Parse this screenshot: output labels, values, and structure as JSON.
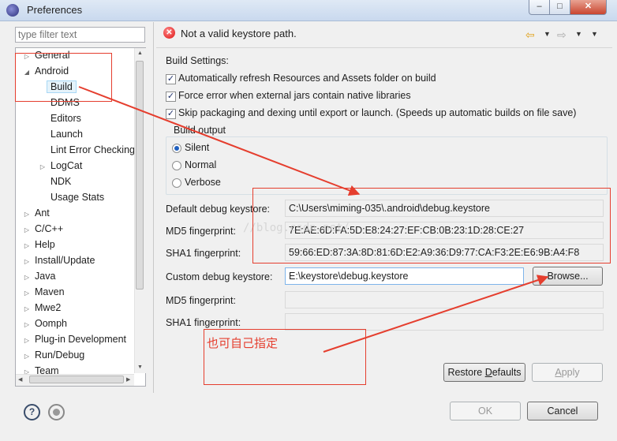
{
  "window": {
    "title": "Preferences",
    "buttons": [
      "–",
      "□",
      "✕"
    ]
  },
  "sidebar": {
    "filter_placeholder": "type filter text",
    "tree": [
      {
        "label": "General",
        "twisty": "▷",
        "depth": 0
      },
      {
        "label": "Android",
        "twisty": "◢",
        "depth": 0
      },
      {
        "label": "Build",
        "twisty": "",
        "depth": 1,
        "selected": true
      },
      {
        "label": "DDMS",
        "twisty": "",
        "depth": 1
      },
      {
        "label": "Editors",
        "twisty": "",
        "depth": 1
      },
      {
        "label": "Launch",
        "twisty": "",
        "depth": 1
      },
      {
        "label": "Lint Error Checking",
        "twisty": "",
        "depth": 1
      },
      {
        "label": "LogCat",
        "twisty": "▷",
        "depth": 1
      },
      {
        "label": "NDK",
        "twisty": "",
        "depth": 1
      },
      {
        "label": "Usage Stats",
        "twisty": "",
        "depth": 1
      },
      {
        "label": "Ant",
        "twisty": "▷",
        "depth": 0
      },
      {
        "label": "C/C++",
        "twisty": "▷",
        "depth": 0
      },
      {
        "label": "Help",
        "twisty": "▷",
        "depth": 0
      },
      {
        "label": "Install/Update",
        "twisty": "▷",
        "depth": 0
      },
      {
        "label": "Java",
        "twisty": "▷",
        "depth": 0
      },
      {
        "label": "Maven",
        "twisty": "▷",
        "depth": 0
      },
      {
        "label": "Mwe2",
        "twisty": "▷",
        "depth": 0
      },
      {
        "label": "Oomph",
        "twisty": "▷",
        "depth": 0
      },
      {
        "label": "Plug-in Development",
        "twisty": "▷",
        "depth": 0
      },
      {
        "label": "Run/Debug",
        "twisty": "▷",
        "depth": 0
      },
      {
        "label": "Team",
        "twisty": "▷",
        "depth": 0
      }
    ]
  },
  "header": {
    "message": "Not a valid keystore path."
  },
  "build_settings": {
    "title": "Build Settings:",
    "options": [
      {
        "label": "Automatically refresh Resources and Assets folder on build",
        "checked": true
      },
      {
        "label": "Force error when external jars contain native libraries",
        "checked": true
      },
      {
        "label": "Skip packaging and dexing until export or launch. (Speeds up automatic builds on file save)",
        "checked": true
      }
    ],
    "output_group": "Build output",
    "output_options": [
      {
        "label": "Silent",
        "selected": true
      },
      {
        "label": "Normal",
        "selected": false
      },
      {
        "label": "Verbose",
        "selected": false
      }
    ]
  },
  "keystore": {
    "default_label": "Default debug keystore:",
    "default_value": "C:\\Users\\miming-035\\.android\\debug.keystore",
    "md5_label": "MD5 fingerprint:",
    "md5_value": "7E:AE:6D:FA:5D:E8:24:27:EF:CB:0B:23:1D:28:CE:27",
    "sha1_label": "SHA1 fingerprint:",
    "sha1_value": "59:66:ED:87:3A:8D:81:6D:E2:A9:36:D9:77:CA:F3:2E:E6:9B:A4:F8",
    "custom_label": "Custom debug keystore:",
    "custom_value": "E:\\keystore\\debug.keystore",
    "browse_label": "Browse...",
    "custom_md5_label": "MD5 fingerprint:",
    "custom_md5_value": "",
    "custom_sha1_label": "SHA1 fingerprint:",
    "custom_sha1_value": ""
  },
  "buttons": {
    "restore_prefix": "Restore ",
    "restore_mnemonic": "D",
    "restore_suffix": "efaults",
    "apply_mnemonic": "A",
    "apply_suffix": "pply",
    "ok": "OK",
    "cancel": "Cancel"
  },
  "annotation": {
    "note": "也可自己指定",
    "color": "#e53e2e"
  },
  "watermark": "//blog.csdn.net/"
}
